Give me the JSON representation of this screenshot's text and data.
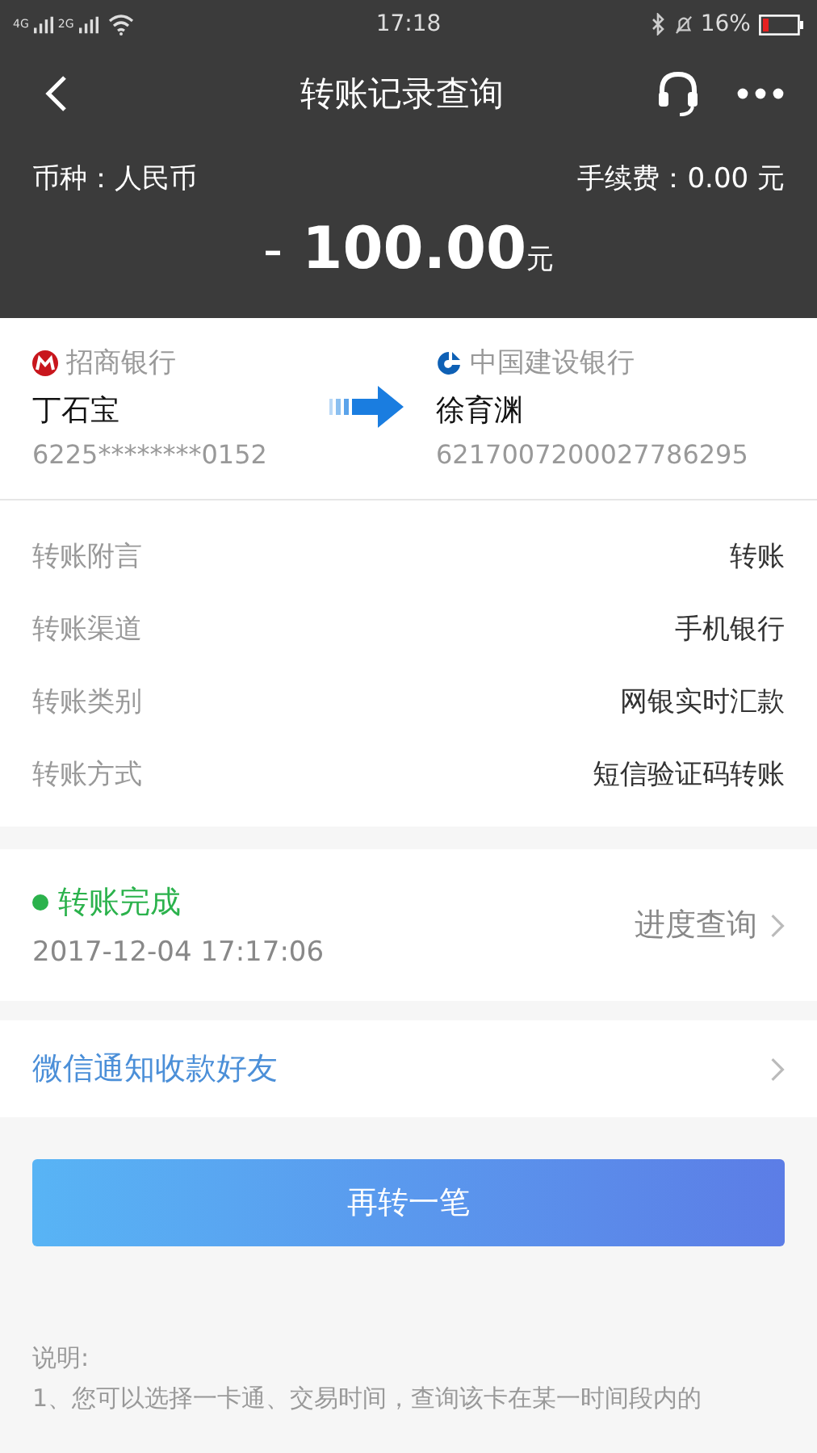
{
  "status_bar": {
    "signal_1": "4G",
    "signal_2": "2G",
    "time": "17:18",
    "battery": "16%"
  },
  "header": {
    "title": "转账记录查询"
  },
  "summary": {
    "currency": "币种：人民币",
    "fee": "手续费：0.00 元",
    "sign": "-",
    "amount": "100.00",
    "unit": "元"
  },
  "transfer": {
    "from": {
      "bank": "招商银行",
      "name": "丁石宝",
      "account": "6225********0152"
    },
    "to": {
      "bank": "中国建设银行",
      "name": "徐育渊",
      "account": "6217007200027786295"
    }
  },
  "details": [
    {
      "label": "转账附言",
      "value": "转账"
    },
    {
      "label": "转账渠道",
      "value": "手机银行"
    },
    {
      "label": "转账类别",
      "value": "网银实时汇款"
    },
    {
      "label": "转账方式",
      "value": "短信验证码转账"
    }
  ],
  "status": {
    "text": "转账完成",
    "color": "#2bb24c",
    "time": "2017-12-04 17:17:06",
    "link": "进度查询"
  },
  "notify": {
    "text": "微信通知收款好友"
  },
  "primary_button": "再转一笔",
  "notes": {
    "title": "说明:",
    "lines": [
      "1、您可以选择一卡通、交易时间，查询该卡在某一时间段内的"
    ]
  }
}
